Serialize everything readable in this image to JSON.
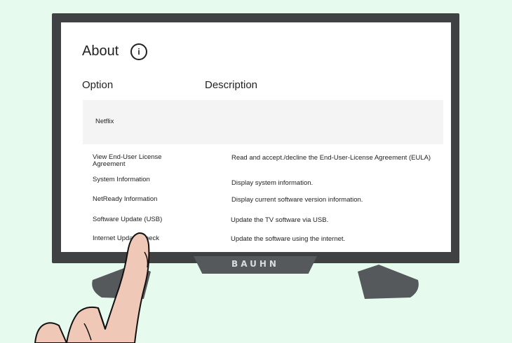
{
  "tv": {
    "brand": "BAUHN"
  },
  "page": {
    "title": "About",
    "info_icon": "i"
  },
  "table": {
    "headers": {
      "option": "Option",
      "description": "Description"
    },
    "highlighted": {
      "option": "Netflix",
      "description": ""
    },
    "rows": [
      {
        "option": "View End-User License Agreement",
        "description": "Read and accept./decline the End-User-License Agreement (EULA)"
      },
      {
        "option": "System Information",
        "description": "Display system information."
      },
      {
        "option": "NetReady Information",
        "description": "Display current software version information."
      },
      {
        "option": "Software Update (USB)",
        "description": "Update the TV software via USB."
      },
      {
        "option": "Internet Update Check",
        "description": "Update the software using the internet."
      }
    ]
  },
  "colors": {
    "background": "#e6fbee",
    "bezel": "#3f4143",
    "screen": "#ffffff",
    "highlight": "#f5f4f4",
    "skin": "#efc8b8"
  }
}
